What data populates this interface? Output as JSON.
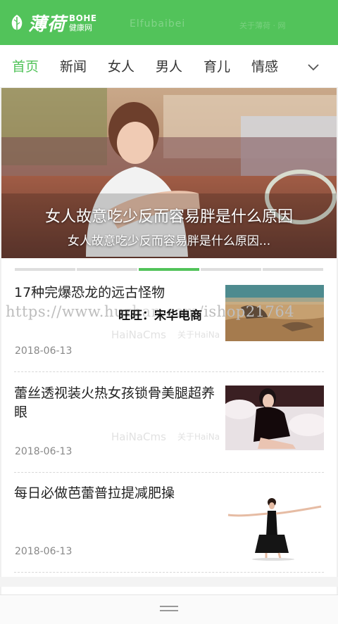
{
  "header": {
    "logo_cn": "薄荷",
    "logo_en": "BOHE",
    "logo_tag": "健康网",
    "watermark": "Elfubaibei",
    "watermark2": "关于薄荷 · 网"
  },
  "nav": {
    "items": [
      "首页",
      "新闻",
      "女人",
      "男人",
      "育儿",
      "情感"
    ],
    "active_index": 0,
    "more_icon": "chevron-down-icon"
  },
  "banner": {
    "title": "女人故意吃少反而容易胖是什么原因",
    "subtitle": "女人故意吃少反而容易胖是什么原因...",
    "slides_total": 5,
    "active_slide": 3
  },
  "watermark": {
    "url_text": "https://www.huzhan.com/ishop21764",
    "center_text": "旺旺：宋华电商",
    "ghost_brand": "HaiNaCms",
    "ghost_tag": "关于HaiNa"
  },
  "news": [
    {
      "title": "17种完爆恐龙的远古怪物",
      "date": "2018-06-13"
    },
    {
      "title": "蕾丝透视装火热女孩锁骨美腿超养眼",
      "date": "2018-06-13"
    },
    {
      "title": "每日必做芭蕾普拉提减肥操",
      "date": "2018-06-13"
    }
  ],
  "colors": {
    "brand_green": "#52c35a",
    "text_dark": "#222222",
    "date_gray": "#888888"
  }
}
